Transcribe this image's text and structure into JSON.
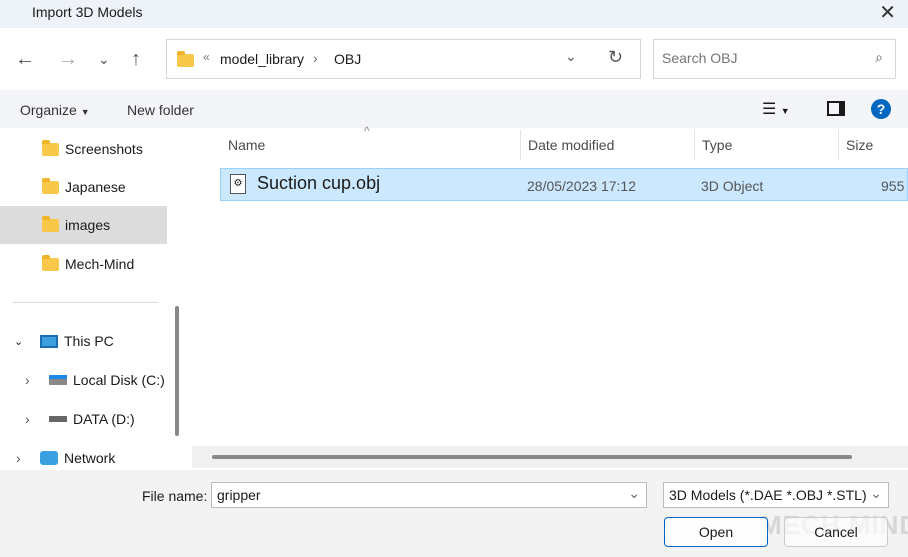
{
  "window": {
    "title": "Import 3D Models"
  },
  "address": {
    "crumbs": [
      "model_library",
      "OBJ"
    ],
    "overflow": "«"
  },
  "search": {
    "placeholder": "Search OBJ"
  },
  "toolbar": {
    "organize": "Organize",
    "new_folder": "New folder"
  },
  "sidebar": {
    "items": [
      {
        "label": "Screenshots",
        "icon": "folder-icon"
      },
      {
        "label": "Japanese",
        "icon": "folder-icon"
      },
      {
        "label": "images",
        "icon": "folder-icon",
        "selected": true
      },
      {
        "label": "Mech-Mind",
        "icon": "folder-icon"
      },
      {
        "label": "This PC",
        "icon": "pc-icon",
        "expanded": true
      },
      {
        "label": "Local Disk (C:)",
        "icon": "windows-drive-icon"
      },
      {
        "label": "DATA (D:)",
        "icon": "drive-icon"
      },
      {
        "label": "Network",
        "icon": "network-icon"
      }
    ]
  },
  "columns": {
    "name": "Name",
    "date": "Date modified",
    "type": "Type",
    "size": "Size"
  },
  "files": [
    {
      "name": "Suction cup.obj",
      "date": "28/05/2023 17:12",
      "type": "3D Object",
      "size": "955"
    }
  ],
  "footer": {
    "file_name_label": "File name:",
    "file_name_value": "gripper",
    "filter": "3D Models (*.DAE *.OBJ *.STL)",
    "open": "Open",
    "cancel": "Cancel"
  },
  "watermark": "MECH MIND",
  "colors": {
    "selection": "#cce8ff",
    "accent": "#0067c0"
  }
}
